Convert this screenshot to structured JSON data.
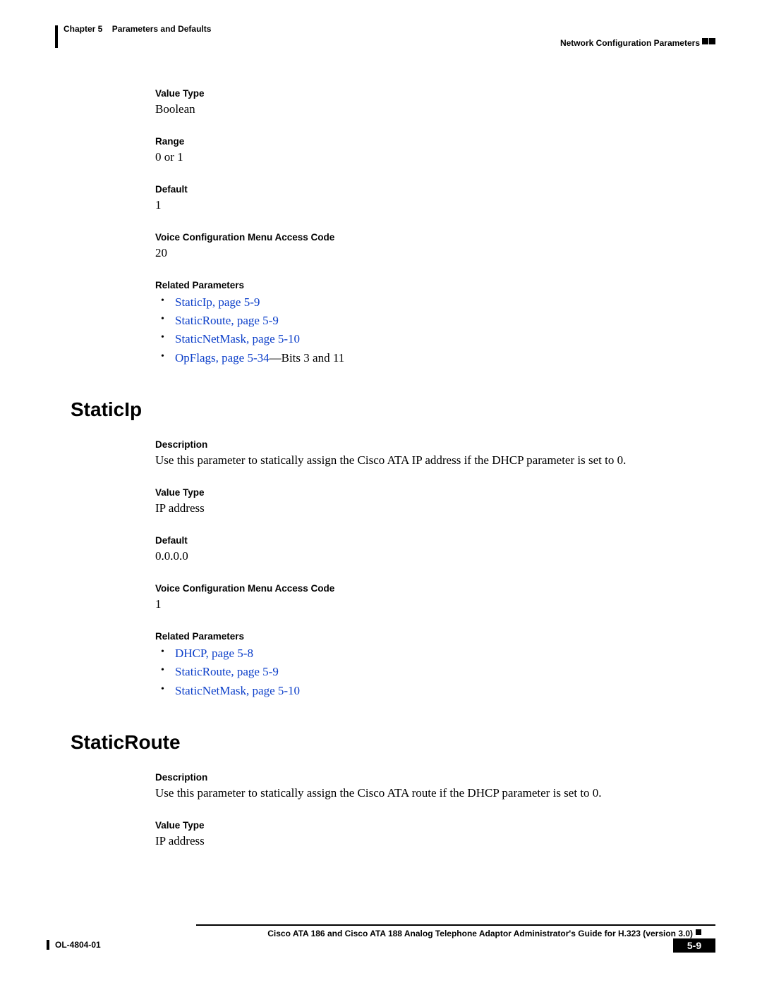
{
  "header": {
    "chapter_label": "Chapter 5",
    "chapter_title": "Parameters and Defaults",
    "section": "Network Configuration Parameters"
  },
  "dhcp_tail": {
    "value_type_label": "Value Type",
    "value_type": "Boolean",
    "range_label": "Range",
    "range": "0 or 1",
    "default_label": "Default",
    "default": "1",
    "vcmac_label": "Voice Configuration Menu Access Code",
    "vcmac": "20",
    "related_label": "Related Parameters",
    "related": [
      {
        "link": "StaticIp, page 5-9",
        "suffix": ""
      },
      {
        "link": "StaticRoute, page 5-9",
        "suffix": ""
      },
      {
        "link": "StaticNetMask, page 5-10",
        "suffix": ""
      },
      {
        "link": "OpFlags, page 5-34",
        "suffix": "—Bits 3 and 11"
      }
    ]
  },
  "static_ip": {
    "heading": "StaticIp",
    "description_label": "Description",
    "description": "Use this parameter to statically assign the Cisco ATA IP address if the DHCP parameter is set to 0.",
    "value_type_label": "Value Type",
    "value_type": "IP address",
    "default_label": "Default",
    "default": "0.0.0.0",
    "vcmac_label": "Voice Configuration Menu Access Code",
    "vcmac": "1",
    "related_label": "Related Parameters",
    "related": [
      {
        "link": "DHCP, page 5-8",
        "suffix": ""
      },
      {
        "link": "StaticRoute, page 5-9",
        "suffix": ""
      },
      {
        "link": "StaticNetMask, page 5-10",
        "suffix": ""
      }
    ]
  },
  "static_route": {
    "heading": "StaticRoute",
    "description_label": "Description",
    "description": "Use this parameter to statically assign the Cisco ATA route if the DHCP parameter is set to 0.",
    "value_type_label": "Value Type",
    "value_type": "IP address"
  },
  "footer": {
    "book_title": "Cisco ATA 186 and Cisco ATA 188 Analog Telephone Adaptor Administrator's Guide for H.323 (version 3.0)",
    "doc_id": "OL-4804-01",
    "page": "5-9"
  }
}
